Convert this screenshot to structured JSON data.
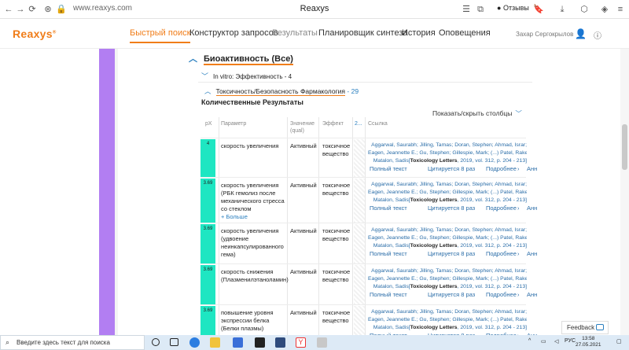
{
  "browser": {
    "url": "www.reaxys.com",
    "title": "Reaxys",
    "reviews_label": "Отзывы"
  },
  "app": {
    "logo": "Reaxys",
    "nav": [
      "Быстрый поиск",
      "Конструктор запросов",
      "Результаты",
      "Планировщик синтеза",
      "История",
      "Оповещения"
    ],
    "active_nav": "Быстрый поиск",
    "user": "Захар Сергокрылов"
  },
  "section": {
    "title": "Биоактивность (Все)",
    "invitro": "In vitro: Эффективность - 4",
    "tox_label": "Токсичность/Безопасность Фармакология",
    "tox_count": "- 29",
    "quant_title": "Количественные Результаты",
    "show_hide": "Показать/скрыть столбцы"
  },
  "table": {
    "headers": {
      "px": "pX",
      "param": "Параметр",
      "value": "Значение",
      "value_sub": "(qual)",
      "effect": "Эффект",
      "col2": "2...",
      "ref": "Ссылка"
    },
    "ref_authors_1": "Aggarwal, Saurabh; Jilling, Tamas; Doran, Stephen; Ahmad, Israr;",
    "ref_authors_2": "Eagen, Jeannette E.; Gu, Stephen; Gillespie, Mark; (...) Patel, Rakesh P.;",
    "ref_authors_3": "Matalon, Sadis",
    "ref_journal": "Toxicology Letters",
    "ref_detail": ", 2019, vol. 312, p. 204 - 213",
    "full_text": "Полный текст",
    "cited": "Цитируется 8 раз",
    "more": "Подробнее",
    "ann": "Анн",
    "more_label": "+ Больше",
    "rows": [
      {
        "px": "4",
        "param": "скорость увеличения",
        "value": "Активный",
        "effect": "токсичное вещество",
        "more": false
      },
      {
        "px": "3.69",
        "param": "скорость увеличения (РБК гемолиз после механического стресса со стеклом",
        "value": "Активный",
        "effect": "токсичное вещество",
        "more": true
      },
      {
        "px": "3.69",
        "param": "скорость увеличения (удвоение неинкапсулированного гема)",
        "value": "Активный",
        "effect": "токсичное вещество",
        "more": false
      },
      {
        "px": "3.69",
        "param": "скорость снижения (Плазменилэтаноламин)",
        "value": "Активный",
        "effect": "токсичное вещество",
        "more": false
      },
      {
        "px": "3.69",
        "param": "повышение уровня экспрессии белка (Белки плазмы)",
        "value": "Активный",
        "effect": "токсичное вещество",
        "more": false
      }
    ]
  },
  "feedback": "Feedback",
  "taskbar": {
    "search_placeholder": "Введите здесь текст для поиска",
    "lang": "РУС",
    "time": "13:58",
    "date": "27.05.2021"
  }
}
